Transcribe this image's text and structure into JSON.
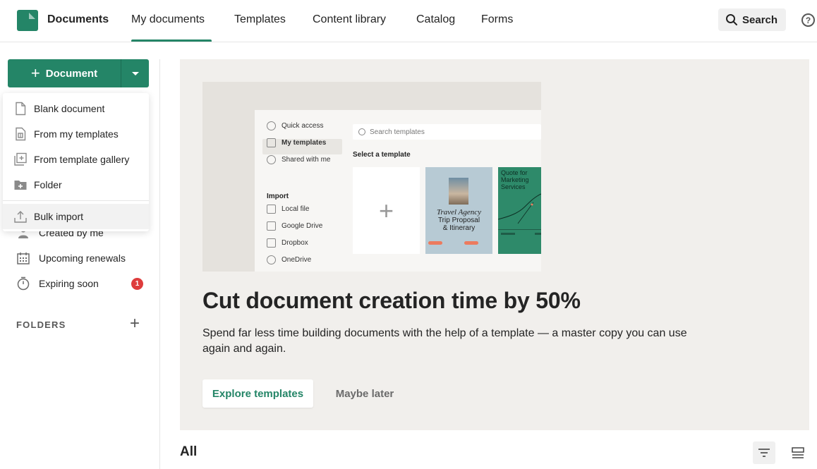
{
  "app": {
    "title": "Documents"
  },
  "nav": {
    "tabs": [
      {
        "label": "My documents",
        "active": true
      },
      {
        "label": "Templates"
      },
      {
        "label": "Content library"
      },
      {
        "label": "Catalog"
      },
      {
        "label": "Forms"
      }
    ],
    "search_label": "Search",
    "help_glyph": "?"
  },
  "sidebar": {
    "create_button": {
      "plus": "+",
      "label": "Document"
    },
    "dropdown": [
      {
        "label": "Blank document",
        "icon": "blank-document-icon"
      },
      {
        "label": "From my templates",
        "icon": "my-templates-icon"
      },
      {
        "label": "From template gallery",
        "icon": "template-gallery-icon"
      },
      {
        "label": "Folder",
        "icon": "folder-add-icon"
      },
      {
        "label": "Bulk import",
        "icon": "upload-icon"
      }
    ],
    "items": [
      {
        "label": "Created by me",
        "icon": "person-icon"
      },
      {
        "label": "Upcoming renewals",
        "icon": "calendar-icon"
      },
      {
        "label": "Expiring soon",
        "icon": "stopwatch-icon",
        "badge": "1"
      }
    ],
    "folders_label": "FOLDERS",
    "folders_add": "+"
  },
  "banner": {
    "preview": {
      "nav": [
        "Quick access",
        "My templates",
        "Shared with me"
      ],
      "import_label": "Import",
      "import_items": [
        "Local file",
        "Google Drive",
        "Dropbox",
        "OneDrive"
      ],
      "search_placeholder": "Search templates",
      "select_label": "Select a template",
      "blank_plus": "+",
      "travel_title": "Travel Agency",
      "travel_sub1": "Trip Proposal",
      "travel_sub2": "& Itinerary",
      "quote_title": "Quote for Marketing Services"
    },
    "headline": "Cut document creation time by 50%",
    "subtext": "Spend far less time building documents with the help of a template — a master copy you can use again and again.",
    "primary_button": "Explore templates",
    "secondary_button": "Maybe later"
  },
  "list": {
    "title": "All"
  },
  "colors": {
    "accent": "#248567",
    "badge": "#de3c3c",
    "banner_bg": "#f1efec"
  }
}
